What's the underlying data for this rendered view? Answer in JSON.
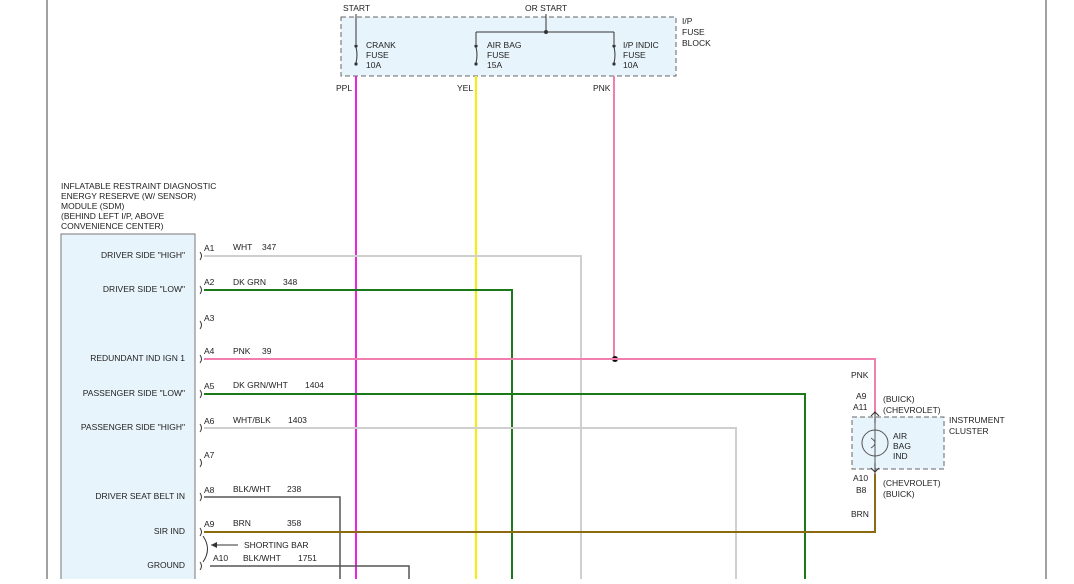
{
  "fuse_block": {
    "label_lines": [
      "I/P",
      "FUSE",
      "BLOCK"
    ],
    "start_label": "START",
    "or_start_label": "OR START",
    "fuses": [
      {
        "lines": [
          "CRANK",
          "FUSE",
          "10A"
        ],
        "wire_color": "PPL"
      },
      {
        "lines": [
          "AIR BAG",
          "FUSE",
          "15A"
        ],
        "wire_color": "YEL"
      },
      {
        "lines": [
          "I/P INDIC",
          "FUSE",
          "10A"
        ],
        "wire_color": "PNK"
      }
    ]
  },
  "sdm": {
    "title_lines": [
      "INFLATABLE RESTRAINT DIAGNOSTIC",
      "ENERGY RESERVE (W/ SENSOR)",
      "MODULE (SDM)",
      "(BEHIND LEFT I/P, ABOVE",
      "CONVENIENCE CENTER)"
    ],
    "pins": [
      {
        "name": "DRIVER SIDE \"HIGH\"",
        "pin": "A1",
        "wire": "WHT",
        "circuit": "347"
      },
      {
        "name": "DRIVER SIDE \"LOW\"",
        "pin": "A2",
        "wire": "DK GRN",
        "circuit": "348"
      },
      {
        "name": "",
        "pin": "A3",
        "wire": "",
        "circuit": ""
      },
      {
        "name": "REDUNDANT IND IGN 1",
        "pin": "A4",
        "wire": "PNK",
        "circuit": "39"
      },
      {
        "name": "PASSENGER SIDE \"LOW\"",
        "pin": "A5",
        "wire": "DK GRN/WHT",
        "circuit": "1404"
      },
      {
        "name": "PASSENGER SIDE \"HIGH\"",
        "pin": "A6",
        "wire": "WHT/BLK",
        "circuit": "1403"
      },
      {
        "name": "",
        "pin": "A7",
        "wire": "",
        "circuit": ""
      },
      {
        "name": "DRIVER SEAT BELT IN",
        "pin": "A8",
        "wire": "BLK/WHT",
        "circuit": "238"
      },
      {
        "name": "SIR IND",
        "pin": "A9",
        "wire": "BRN",
        "circuit": "358"
      },
      {
        "name": "GROUND",
        "pin": "A10",
        "wire": "BLK/WHT",
        "circuit": "1751"
      }
    ],
    "shorting_bar": "SHORTING BAR"
  },
  "cluster": {
    "label_lines": [
      "INSTRUMENT",
      "CLUSTER"
    ],
    "indicator_lines": [
      "AIR",
      "BAG",
      "IND"
    ],
    "top_wire": "PNK",
    "top_pins": [
      {
        "pin": "A9",
        "make": "(BUICK)"
      },
      {
        "pin": "A11",
        "make": "(CHEVROLET)"
      }
    ],
    "bottom_pins": [
      {
        "pin": "A10",
        "make": "(CHEVROLET)"
      },
      {
        "pin": "B8",
        "make": "(BUICK)"
      }
    ],
    "bottom_wire": "BRN"
  },
  "colors": {
    "ppl": "#ee22dd",
    "yel": "#f4f000",
    "pnk": "#f07fb0",
    "wht": "#cfcfcf",
    "grn": "#1a7a1a",
    "brn": "#8b6a12",
    "blk": "#555555",
    "box_fill": "#e8f4fc"
  }
}
